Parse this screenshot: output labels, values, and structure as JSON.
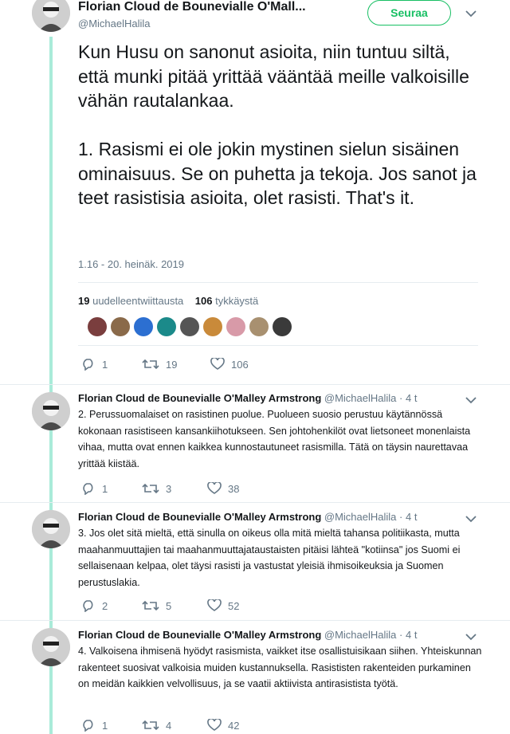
{
  "main_tweet": {
    "author_name": "Florian Cloud de Bounevialle O'Mall...",
    "handle": "@MichaelHalila",
    "follow_label": "Seuraa",
    "text": "Kun Husu on sanonut asioita, niin tuntuu siltä, että munki pitää yrittää vääntää meille valkoisille vähän rautalankaa.\n\n1. Rasismi ei ole jokin mystinen sielun sisäinen ominaisuus. Se on puhetta ja tekoja. Jos sanot ja teet rasistisia asioita, olet rasisti. That's it.",
    "timestamp": "1.16 - 20. heinäk. 2019",
    "retweet_count": "19",
    "retweet_label": "uudelleentwiittausta",
    "like_count": "106",
    "like_label": "tykkäystä",
    "actions": {
      "replies": "1",
      "retweets": "19",
      "likes": "106"
    }
  },
  "replies": [
    {
      "author_name": "Florian Cloud de Bounevialle O'Malley Armstrong",
      "handle": "@MichaelHalila",
      "time": "· 4 t",
      "text": "2. Perussuomalaiset on rasistinen puolue. Puolueen suosio perustuu käytännössä kokonaan rasistiseen kansankiihotukseen. Sen johtohenkilöt ovat lietsoneet monenlaista vihaa, mutta ovat ennen kaikkea kunnostautuneet rasismilla. Tätä on täysin naurettavaa yrittää kiistää.",
      "replies": "1",
      "retweets": "3",
      "likes": "38"
    },
    {
      "author_name": "Florian Cloud de Bounevialle O'Malley Armstrong",
      "handle": "@MichaelHalila",
      "time": "· 4 t",
      "text": "3. Jos olet sitä mieltä, että sinulla on oikeus olla mitä mieltä tahansa politiikasta, mutta maahanmuuttajien tai maahanmuuttajataustaisten pitäisi lähteä \"kotiinsa\" jos Suomi ei sellaisenaan kelpaa, olet täysi rasisti ja vastustat yleisiä ihmisoikeuksia ja Suomen perustuslakia.",
      "replies": "2",
      "retweets": "5",
      "likes": "52"
    },
    {
      "author_name": "Florian Cloud de Bounevialle O'Malley Armstrong",
      "handle": "@MichaelHalila",
      "time": "· 4 t",
      "text": "4. Valkoisena ihmisenä hyödyt rasismista, vaikket itse osallistuisikaan siihen. Yhteiskunnan rakenteet suosivat valkoisia muiden kustannuksella. Rasististen rakenteiden purkaminen on meidän kaikkien velvollisuus, ja se vaatii aktiivista antirasistista työtä.",
      "replies": "1",
      "retweets": "4",
      "likes": "42"
    }
  ],
  "icons": {
    "reply": "reply-icon",
    "retweet": "retweet-icon",
    "like": "heart-icon",
    "more": "chevron-down-icon"
  },
  "colors": {
    "follow_green": "#17bf63",
    "thread_line": "#a9ebd9",
    "secondary_text": "#657786"
  },
  "liker_colors": [
    "#7a3e3e",
    "#8a6a4a",
    "#2c6fd1",
    "#1b8a8a",
    "#555555",
    "#c98a3a",
    "#d89aa8",
    "#a89070",
    "#3a3a3a"
  ]
}
